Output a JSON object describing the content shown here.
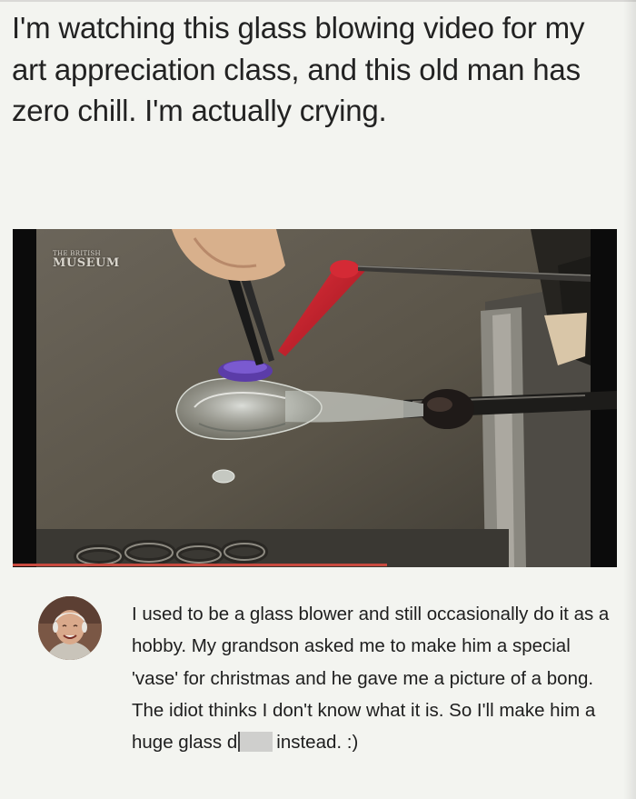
{
  "post": {
    "caption": "I'm watching this glass blowing video for my art appreciation class, and this old man has zero chill. I'm actually crying."
  },
  "video": {
    "watermark_small": "THE BRITISH",
    "watermark_large": "MUSEUM",
    "progress_played": 0.62,
    "accent_color": "#c84a3f"
  },
  "comment": {
    "text_before": "I used to be a glass blower and still occasionally do it as a hobby.  My grandson asked me to make him a special 'vase' for christmas and he gave me a picture of a bong. The idiot thinks I don't know what it is. So I'll make him a huge glass d",
    "text_after": "instead. :)",
    "avatar_icon": "elderly-man-photo"
  }
}
